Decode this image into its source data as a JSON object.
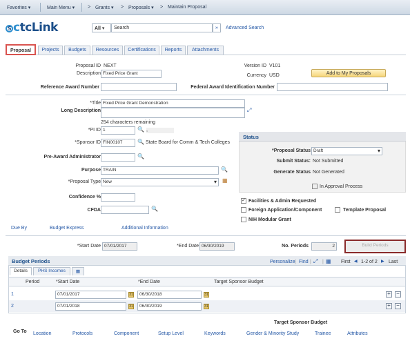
{
  "topbar": {
    "favorites": "Favorites ▾",
    "main_menu": "Main Menu ▾",
    "crumb_grants": "Grants ▾",
    "crumb_proposals": "Proposals ▾",
    "crumb_maintain": "Maintain Proposal",
    "separator": ">"
  },
  "logo": {
    "c": "c",
    "rest": "tcLink",
    "mark": "S"
  },
  "search": {
    "scope": "All",
    "placeholder": "Search",
    "advanced": "Advanced Search",
    "go": "»"
  },
  "tabs": [
    "Proposal",
    "Projects",
    "Budgets",
    "Resources",
    "Certifications",
    "Reports",
    "Attachments"
  ],
  "header": {
    "proposal_id_label": "Proposal ID",
    "proposal_id": "NEXT",
    "description_label": "Description",
    "description": "Fixed Price Grant",
    "version_id_label": "Version ID",
    "version_id": "V101",
    "currency_label": "Currency",
    "currency": "USD",
    "add_button": "Add to My Proposals",
    "ref_award_label": "Reference Award Number",
    "ref_award": "",
    "fed_award_label": "Federal Award Identification Number",
    "fed_award": ""
  },
  "details": {
    "title_label": "*Title",
    "title": "Fixed Price Grant Demonstration",
    "long_desc_label": "Long Description",
    "chars_remaining": "254 characters remaining",
    "pi_label": "*PI ID",
    "pi_id": "1",
    "pi_name": ",",
    "sponsor_label": "*Sponsor ID",
    "sponsor_id": "FIN00107",
    "sponsor_name": "State Board for Comm & Tech Colleges",
    "pre_award_label": "Pre-Award Administrator",
    "pre_award": "",
    "purpose_label": "Purpose",
    "purpose": "TRAIN",
    "proposal_type_label": "*Proposal Type",
    "proposal_type": "New",
    "confidence_label": "Confidence %",
    "confidence": "",
    "cfda_label": "CFDA",
    "cfda": ""
  },
  "status": {
    "title": "Status",
    "proposal_status_label": "*Proposal Status",
    "proposal_status": "Draft",
    "submit_status_label": "Submit Status:",
    "submit_status": "Not Submitted",
    "generate_status_label": "Generate Status",
    "generate_status": "Not Generated",
    "in_approval": "In Approval Process"
  },
  "checkboxes": {
    "facilities": "Facilities & Admin Requested",
    "foreign": "Foreign Application/Component",
    "template": "Template Proposal",
    "nih": "NIH Modular Grant"
  },
  "links": {
    "due_by": "Due By",
    "budget_express": "Budget Express",
    "additional_info": "Additional Information"
  },
  "dates": {
    "start_label": "*Start Date",
    "start": "07/01/2017",
    "end_label": "*End Date",
    "end": "06/30/2019",
    "periods_label": "No. Periods",
    "periods": "2",
    "build_button": "Build Periods"
  },
  "budget_periods": {
    "title": "Budget Periods",
    "personalize": "Personalize",
    "find": "Find",
    "first": "First",
    "range": "1-2 of 2",
    "last": "Last",
    "tab_details": "Details",
    "tab_phs": "PHS Incomes",
    "columns": [
      "Period",
      "*Start Date",
      "*End Date",
      "Target Sponsor Budget"
    ],
    "rows": [
      {
        "period": "1",
        "start": "07/01/2017",
        "end": "06/30/2018"
      },
      {
        "period": "2",
        "start": "07/01/2018",
        "end": "06/30/2019"
      }
    ],
    "cal": "31",
    "add": "+",
    "remove": "−"
  },
  "footer": {
    "target_budget_label": "Target Sponsor Budget",
    "goto": "Go To",
    "links": [
      "Location",
      "Protocols",
      "Component",
      "Setup Level",
      "Keywords",
      "Gender & Minority Study",
      "Trainee",
      "Attributes"
    ]
  },
  "icons": {
    "lookup": "🔍",
    "arrows": "◀ ▶",
    "grid": "▦",
    "zoom": "⤢"
  }
}
